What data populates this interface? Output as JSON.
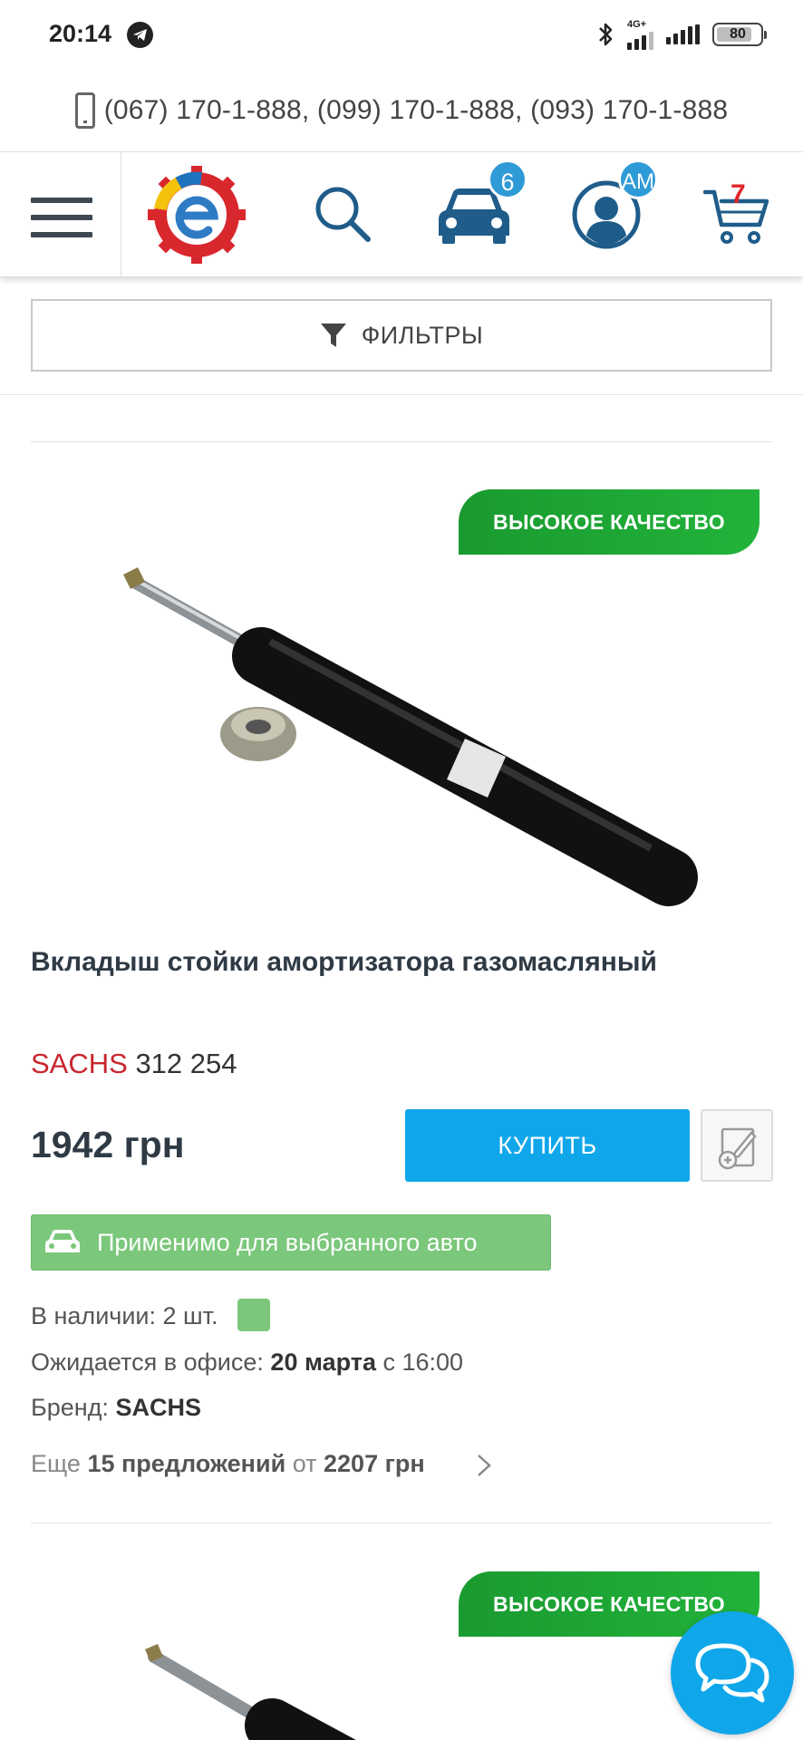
{
  "status_bar": {
    "time": "20:14",
    "network": "4G+",
    "battery": "80"
  },
  "phones": {
    "text": "(067) 170-1-888,  (099) 170-1-888,  (093) 170-1-888"
  },
  "header": {
    "garage_count": "6",
    "user_initials": "AM",
    "cart_count": "7"
  },
  "filters": {
    "label": "ФИЛЬТРЫ"
  },
  "products": [
    {
      "quality_badge": "ВЫСОКОЕ КАЧЕСТВО",
      "title": "Вкладыш стойки амортизатора газомасляный",
      "brand": "SACHS",
      "article": "312 254",
      "price": "1942 грн",
      "buy_label": "КУПИТЬ",
      "applicable_label": "Применимо для выбранного авто",
      "stock_label": "В наличии: 2 шт.",
      "expected_label": "Ожидается в офисе:",
      "expected_date": "20 марта",
      "expected_time": "с 16:00",
      "brand_label": "Бренд:",
      "brand_value": "SACHS",
      "offers_prefix": "Еще",
      "offers_count": "15 предложений",
      "offers_from": "от",
      "offers_price": "2207 грн"
    },
    {
      "quality_badge": "ВЫСОКОЕ КАЧЕСТВО"
    }
  ],
  "colors": {
    "accent_blue": "#10a6ea",
    "brand_red": "#c8262e",
    "quality_green": "#22b33a",
    "applicable_green": "#7bc77b"
  }
}
